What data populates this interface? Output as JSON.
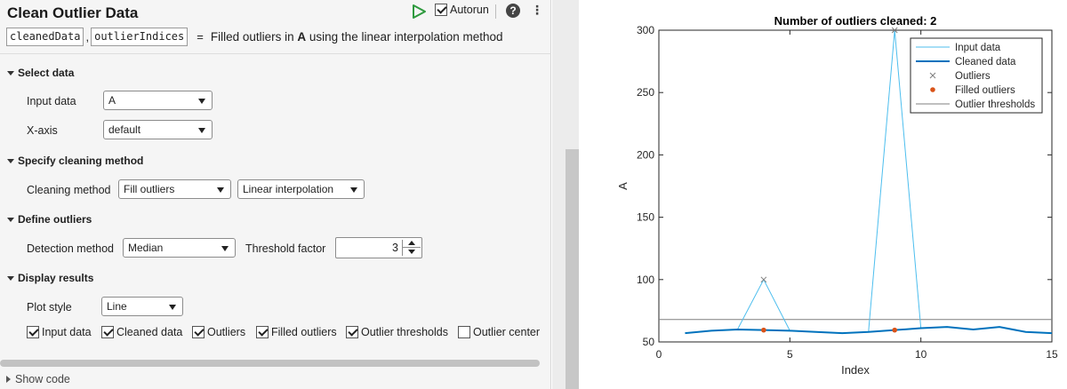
{
  "task": {
    "title": "Clean Outlier Data",
    "autorun_label": "Autorun",
    "help_label": "?",
    "outputs": [
      "cleanedData",
      "outlierIndices"
    ],
    "comma": ",",
    "equals": "=",
    "description_prefix": "Filled outliers in ",
    "description_var": "A",
    "description_suffix": " using the linear interpolation method"
  },
  "sections": {
    "select_data": "Select data",
    "cleaning_method": "Specify cleaning method",
    "define_outliers": "Define outliers",
    "display_results": "Display results"
  },
  "fields": {
    "input_data_label": "Input data",
    "input_data_value": "A",
    "xaxis_label": "X-axis",
    "xaxis_value": "default",
    "cleaning_method_label": "Cleaning method",
    "cleaning_method_value": "Fill outliers",
    "fill_method_value": "Linear interpolation",
    "detection_method_label": "Detection method",
    "detection_method_value": "Median",
    "threshold_label": "Threshold factor",
    "threshold_value": "3",
    "plot_style_label": "Plot style",
    "plot_style_value": "Line"
  },
  "checkboxes": [
    {
      "label": "Input data",
      "checked": true
    },
    {
      "label": "Cleaned data",
      "checked": true
    },
    {
      "label": "Outliers",
      "checked": true
    },
    {
      "label": "Filled outliers",
      "checked": true
    },
    {
      "label": "Outlier thresholds",
      "checked": true
    },
    {
      "label": "Outlier center",
      "checked": false
    }
  ],
  "show_code_label": "Show code",
  "colors": {
    "input": "#4dbeee",
    "cleaned": "#0072bd",
    "outliers": "#7f7f7f",
    "filled": "#d95319",
    "threshold": "#7f7f7f",
    "run": "#2e9a3e"
  },
  "chart_data": {
    "type": "line",
    "title": "Number of outliers cleaned: 2",
    "xlabel": "Index",
    "ylabel": "A",
    "xlim": [
      0,
      15
    ],
    "ylim": [
      50,
      300
    ],
    "xticks": [
      0,
      5,
      10,
      15
    ],
    "yticks": [
      50,
      100,
      150,
      200,
      250,
      300
    ],
    "legend_position": "top-right",
    "series": [
      {
        "name": "Input data",
        "x": [
          1,
          2,
          3,
          4,
          5,
          6,
          7,
          8,
          9,
          10,
          11,
          12,
          13,
          14,
          15
        ],
        "y": [
          57,
          59,
          60,
          100,
          59,
          58,
          57,
          58,
          300,
          61,
          62,
          60,
          62,
          58,
          57
        ]
      },
      {
        "name": "Cleaned data",
        "x": [
          1,
          2,
          3,
          4,
          5,
          6,
          7,
          8,
          9,
          10,
          11,
          12,
          13,
          14,
          15
        ],
        "y": [
          57,
          59,
          60,
          59.5,
          59,
          58,
          57,
          58,
          59.5,
          61,
          62,
          60,
          62,
          58,
          57
        ]
      },
      {
        "name": "Outliers",
        "x": [
          4,
          9
        ],
        "y": [
          100,
          300
        ]
      },
      {
        "name": "Filled outliers",
        "x": [
          4,
          9
        ],
        "y": [
          59.5,
          59.5
        ]
      },
      {
        "name": "Outlier thresholds",
        "y": 68
      }
    ]
  }
}
